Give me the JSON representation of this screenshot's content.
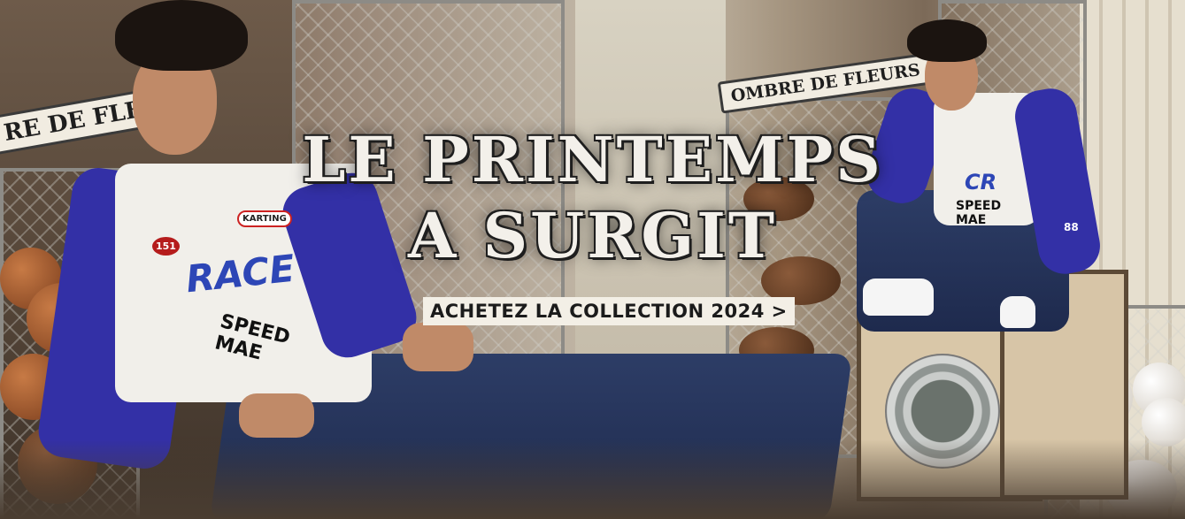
{
  "banner": {
    "headline_line1": "LE PRINTEMPS",
    "headline_line2": "A SURGIT",
    "cta_label": "ACHETEZ LA COLLECTION 2024 >",
    "sign_left": "RE DE FLEURS",
    "sign_right": "OMBRE DE FLEURS"
  },
  "shirt_prints": {
    "left_logo": "RACE",
    "left_sub": "SPEED MAE",
    "left_badge": "KARTING",
    "left_badge2": "151",
    "right_logo": "CR",
    "right_sub": "SPEED MAE",
    "right_number": "88"
  },
  "colors": {
    "sleeve_blue": "#3330a6",
    "denim": "#24325a",
    "cta_background": "#f3efe6",
    "headline_text": "#f3f0ea"
  }
}
